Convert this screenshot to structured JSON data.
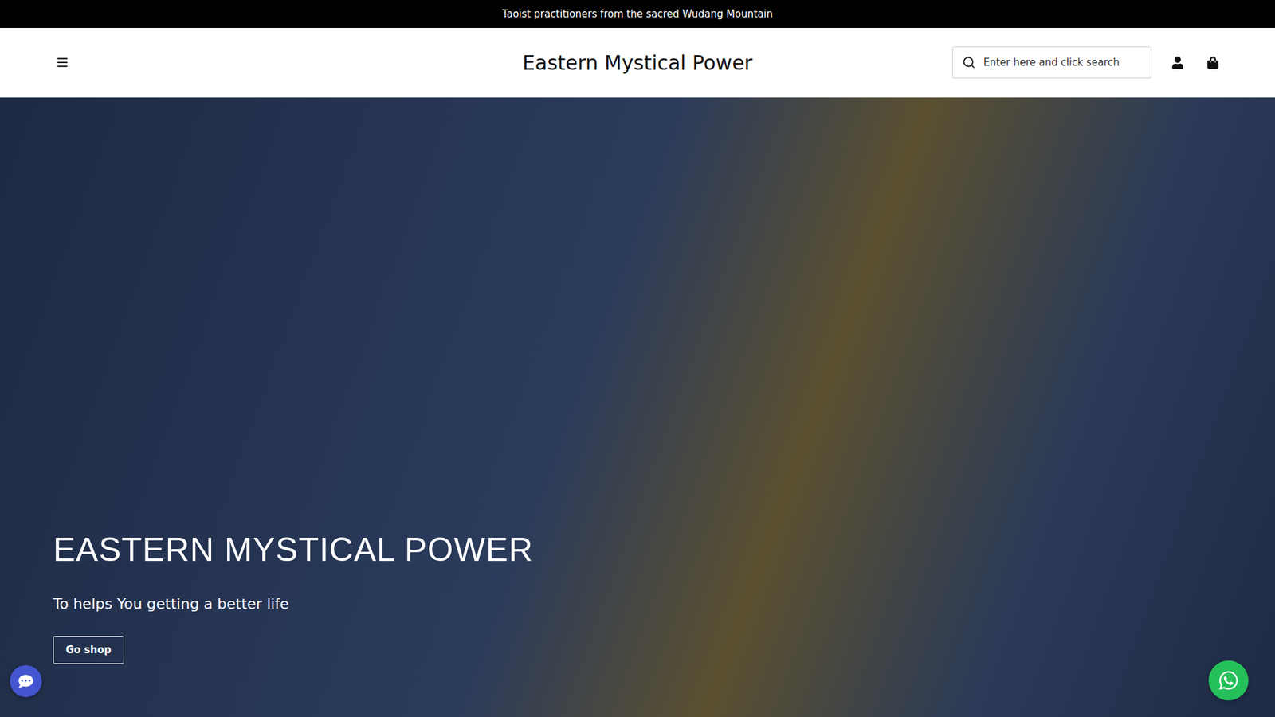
{
  "announcement": {
    "text": "Taoist practitioners from the sacred Wudang Mountain"
  },
  "header": {
    "logo": "Eastern Mystical Power",
    "search": {
      "placeholder": "Enter here and click search"
    }
  },
  "hero": {
    "title": "EASTERN MYSTICAL POWER",
    "subtitle": "To helps You getting a better life",
    "button": "Go shop"
  }
}
